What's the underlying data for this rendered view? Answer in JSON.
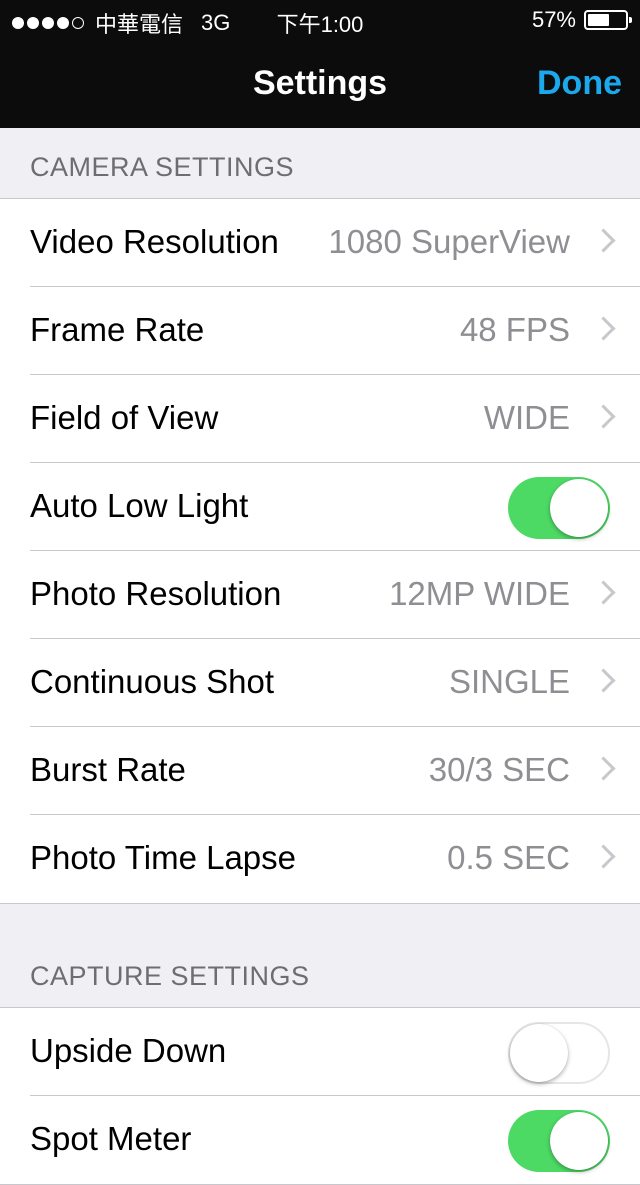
{
  "status_bar": {
    "carrier": "中華電信",
    "network": "3G",
    "time": "下午1:00",
    "battery": "57%",
    "battery_level": 0.57,
    "signal_strength": 4
  },
  "nav": {
    "title": "Settings",
    "done_label": "Done"
  },
  "camera_settings": {
    "header": "CAMERA SETTINGS",
    "rows": [
      {
        "label": "Video Resolution",
        "value": "1080 SuperView"
      },
      {
        "label": "Frame Rate",
        "value": "48 FPS"
      },
      {
        "label": "Field of View",
        "value": "WIDE"
      },
      {
        "label": "Auto Low Light",
        "toggle": true
      },
      {
        "label": "Photo Resolution",
        "value": "12MP WIDE"
      },
      {
        "label": "Continuous Shot",
        "value": "SINGLE"
      },
      {
        "label": "Burst Rate",
        "value": "30/3 SEC"
      },
      {
        "label": "Photo Time Lapse",
        "value": "0.5 SEC"
      }
    ]
  },
  "capture_settings": {
    "header": "CAPTURE SETTINGS",
    "rows": [
      {
        "label": "Upside Down",
        "toggle": false
      },
      {
        "label": "Spot Meter",
        "toggle": true
      }
    ]
  },
  "colors": {
    "accent": "#1ba8ec",
    "toggle_on": "#4cd964",
    "bar": "#0c0c0c",
    "background": "#efeff4"
  }
}
